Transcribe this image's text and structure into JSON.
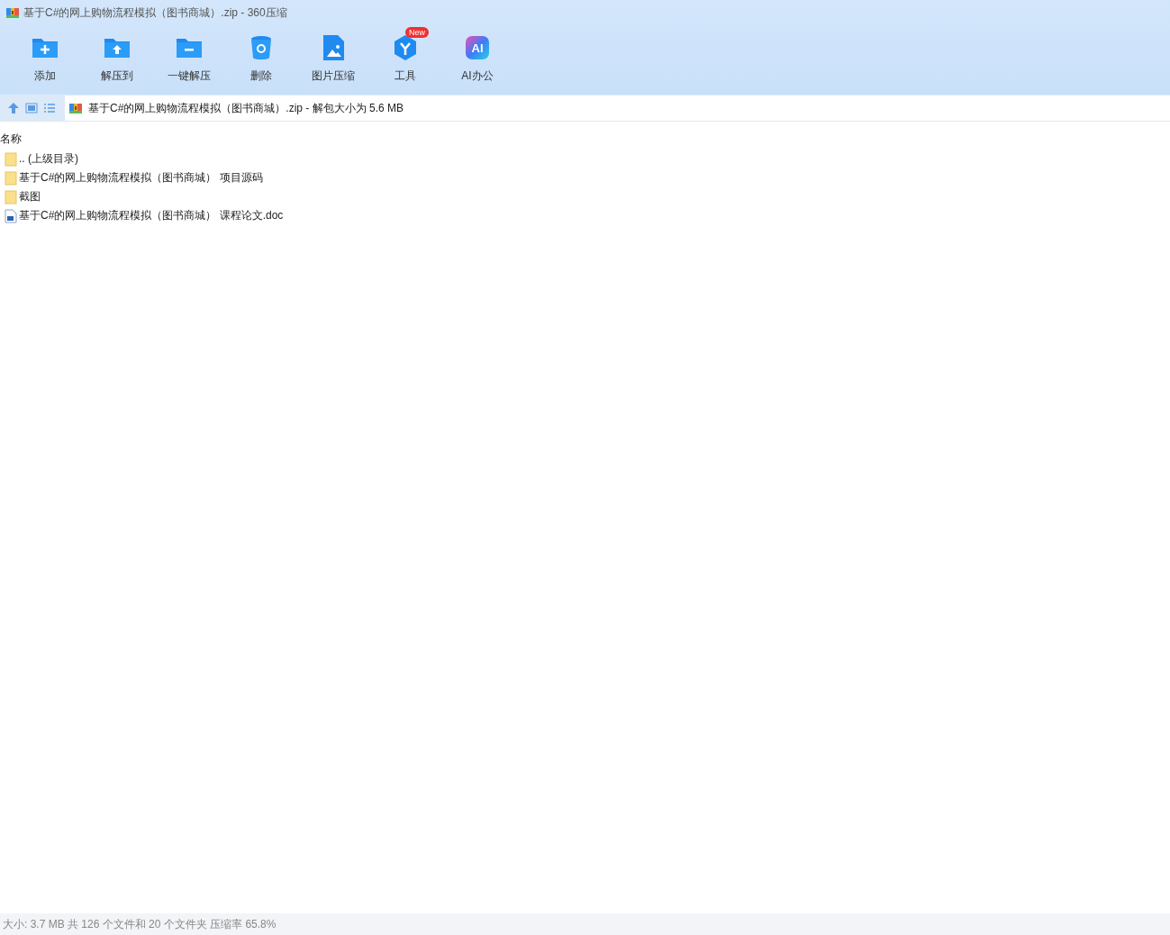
{
  "window": {
    "title": "基于C#的网上购物流程模拟（图书商城）.zip - 360压缩"
  },
  "toolbar": [
    {
      "kind": "add",
      "label": "添加"
    },
    {
      "kind": "extract",
      "label": "解压到"
    },
    {
      "kind": "oneclick",
      "label": "一键解压"
    },
    {
      "kind": "delete",
      "label": "删除"
    },
    {
      "kind": "image",
      "label": "图片压缩"
    },
    {
      "kind": "tools",
      "label": "工具",
      "badge": "New"
    },
    {
      "kind": "ai",
      "label": "AI办公",
      "icon_text": "AI"
    }
  ],
  "address": {
    "value": "基于C#的网上购物流程模拟（图书商城）.zip - 解包大小为 5.6 MB"
  },
  "table": {
    "columns": [
      "名称"
    ],
    "rows": [
      {
        "kind": "folder",
        "name": ".. (上级目录)"
      },
      {
        "kind": "folder",
        "name": "基于C#的网上购物流程模拟（图书商城） 项目源码"
      },
      {
        "kind": "folder",
        "name": "截图"
      },
      {
        "kind": "doc",
        "name": "基于C#的网上购物流程模拟（图书商城） 课程论文.doc"
      }
    ]
  },
  "status_bar": "大小: 3.7 MB 共 126 个文件和 20 个文件夹 压缩率 65.8%"
}
